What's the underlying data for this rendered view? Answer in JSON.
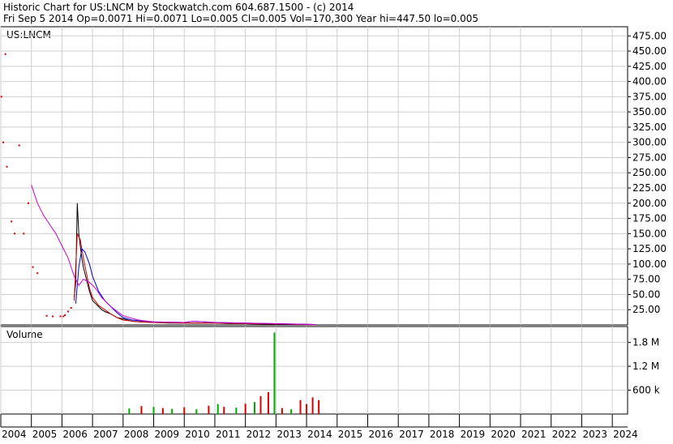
{
  "header": {
    "line1": "Historic Chart for US:LNCM by Stockwatch.com 604.687.1500 - (c) 2014",
    "line2": "Fri Sep  5 2014   Op=0.0071   Hi=0.0071   Lo=0.005   Cl=0.005   Vol=170,300   Year hi=447.50   lo=0.005"
  },
  "colors": {
    "price_bar": "#000000",
    "ma_short": "#cc0000",
    "ma_mid": "#0000cc",
    "ma_long": "#cc00cc",
    "volume_up": "#00aa00",
    "volume_down": "#dd0000",
    "grid": "#cfcfcf",
    "frame": "#000000"
  },
  "chart_data": [
    {
      "type": "line",
      "title": "US:LNCM",
      "y_ticks": [
        "25.00",
        "50.00",
        "75.00",
        "100.00",
        "125.00",
        "150.00",
        "175.00",
        "200.00",
        "225.00",
        "250.00",
        "275.00",
        "300.00",
        "325.00",
        "350.00",
        "375.00",
        "400.00",
        "425.00",
        "450.00",
        "475.00"
      ],
      "ylim": [
        0,
        490
      ],
      "x_ticks": [
        "2004",
        "2005",
        "2006",
        "2007",
        "2008",
        "2009",
        "2010",
        "2011",
        "2012",
        "2013",
        "2014",
        "2015",
        "2016",
        "2017",
        "2018",
        "2019",
        "2020",
        "2021",
        "2022",
        "2023",
        "2024"
      ],
      "xlim": [
        2004.0,
        2024.5
      ],
      "grid": true,
      "series": [
        {
          "style": "price",
          "x": [
            2004.02,
            2004.08,
            2004.15,
            2004.2,
            2004.35,
            2004.45,
            2004.6,
            2004.75,
            2004.9,
            2005.05,
            2005.2,
            2005.5,
            2005.7,
            2005.95,
            2006.05,
            2006.1,
            2006.2,
            2006.3,
            2006.4,
            2006.45,
            2006.5,
            2006.55,
            2006.6,
            2006.65,
            2006.7,
            2006.8,
            2006.9,
            2007.0,
            2007.1,
            2007.2,
            2007.3,
            2007.4,
            2007.5,
            2007.6,
            2007.7,
            2007.8,
            2008.0,
            2008.3,
            2008.6,
            2009.0,
            2009.5,
            2010.0,
            2010.5,
            2011.0,
            2011.5,
            2012.0,
            2012.5,
            2013.0,
            2013.5,
            2014.0,
            2014.3
          ],
          "values": [
            375,
            300,
            445,
            260,
            170,
            150,
            295,
            150,
            200,
            95,
            85,
            15,
            14,
            14,
            14,
            16,
            22,
            28,
            45,
            70,
            200,
            150,
            130,
            110,
            95,
            75,
            55,
            40,
            35,
            30,
            25,
            22,
            20,
            18,
            15,
            12,
            10,
            6,
            5,
            4,
            3,
            3,
            3,
            3,
            2,
            2,
            1.5,
            1,
            0.5,
            0.02,
            0.005
          ]
        },
        {
          "style": "ma_short",
          "x": [
            2006.4,
            2006.5,
            2006.6,
            2006.7,
            2006.8,
            2006.9,
            2007.0,
            2007.2,
            2007.4,
            2007.6,
            2007.8,
            2008.0,
            2008.5,
            2009.0,
            2010.0,
            2011.0,
            2012.0,
            2013.0,
            2014.0,
            2014.3
          ],
          "values": [
            40,
            150,
            140,
            110,
            85,
            60,
            45,
            32,
            25,
            18,
            12,
            8,
            5,
            4,
            3,
            3,
            2,
            1.5,
            0.5,
            0.1
          ]
        },
        {
          "style": "ma_mid",
          "x": [
            2006.45,
            2006.55,
            2006.65,
            2006.75,
            2006.9,
            2007.0,
            2007.2,
            2007.4,
            2007.6,
            2007.8,
            2008.0,
            2008.3,
            2009.0,
            2010.0,
            2010.3,
            2011.0,
            2012.0,
            2013.0,
            2014.0,
            2014.3
          ],
          "values": [
            35,
            95,
            125,
            120,
            100,
            80,
            55,
            40,
            30,
            20,
            12,
            8,
            5,
            4,
            6,
            4,
            3,
            2,
            1,
            0.5
          ]
        },
        {
          "style": "ma_long",
          "x": [
            2005.0,
            2005.2,
            2005.4,
            2005.6,
            2005.8,
            2006.0,
            2006.2,
            2006.4,
            2006.55,
            2006.7,
            2006.9,
            2007.1,
            2007.3,
            2007.6,
            2008.0,
            2008.5,
            2009.0,
            2010.0,
            2010.3,
            2011.0,
            2012.0,
            2013.0,
            2014.0,
            2014.3
          ],
          "values": [
            230,
            200,
            180,
            165,
            150,
            130,
            110,
            80,
            65,
            75,
            70,
            60,
            45,
            30,
            15,
            8,
            5,
            4,
            6,
            4,
            3,
            2,
            1,
            0.5
          ]
        }
      ]
    },
    {
      "type": "bar",
      "title": "Volume",
      "y_ticks": [
        "600 k",
        "1.2 M",
        "1.8 M"
      ],
      "ylim": [
        0,
        2200000
      ],
      "xlim": [
        2004.0,
        2024.5
      ],
      "x": [
        2008.2,
        2008.6,
        2009.0,
        2009.3,
        2009.6,
        2010.0,
        2010.4,
        2010.8,
        2011.1,
        2011.3,
        2011.7,
        2012.0,
        2012.3,
        2012.5,
        2012.75,
        2012.95,
        2013.2,
        2013.5,
        2013.8,
        2014.0,
        2014.2,
        2014.4
      ],
      "values": [
        140000,
        200000,
        180000,
        150000,
        130000,
        170000,
        120000,
        210000,
        250000,
        180000,
        160000,
        260000,
        300000,
        450000,
        550000,
        2050000,
        150000,
        120000,
        350000,
        250000,
        420000,
        350000
      ],
      "colors": [
        "up",
        "down",
        "up",
        "down",
        "up",
        "down",
        "up",
        "down",
        "up",
        "down",
        "up",
        "down",
        "up",
        "down",
        "down",
        "up",
        "down",
        "up",
        "down",
        "down",
        "down",
        "down"
      ]
    }
  ]
}
